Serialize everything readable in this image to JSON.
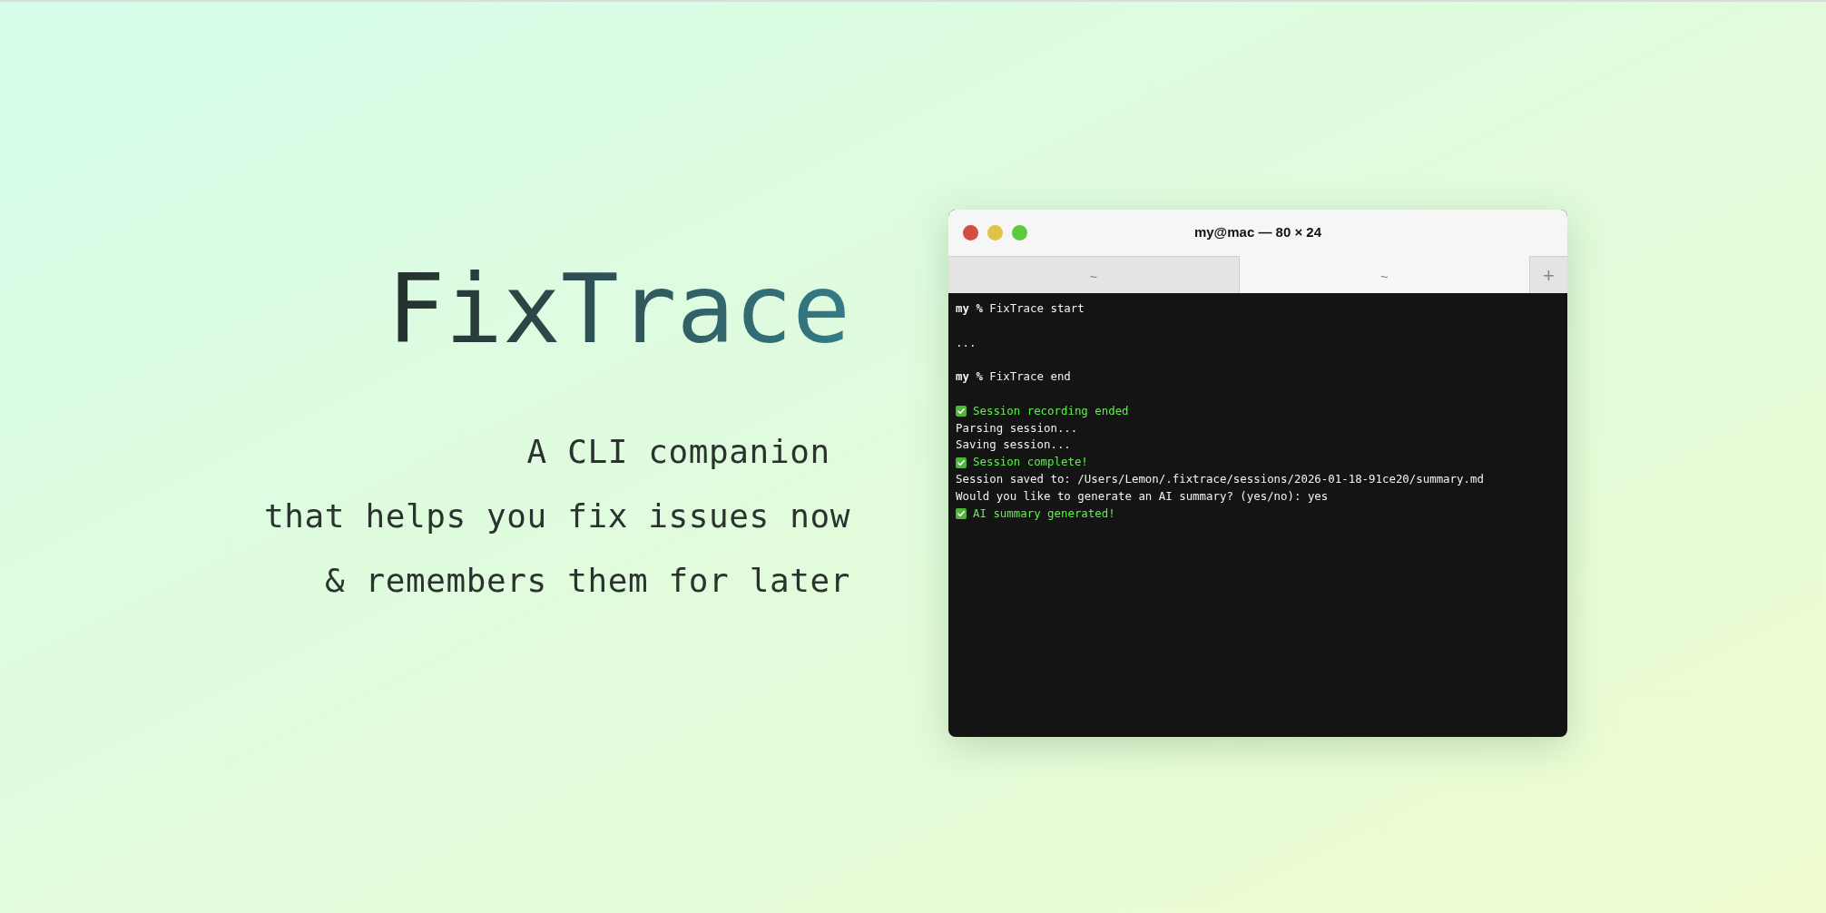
{
  "hero": {
    "title": "FixTrace",
    "tagline": [
      "A CLI companion ",
      "that helps you fix issues now",
      "& remembers them for later"
    ]
  },
  "terminal": {
    "window_title": "my@mac — 80 × 24",
    "traffic_lights": [
      {
        "color": "#d14d45"
      },
      {
        "color": "#e0c44a"
      },
      {
        "color": "#5cc93f"
      }
    ],
    "tabs": [
      {
        "label": "~",
        "selected": false
      },
      {
        "label": "~",
        "selected": true
      }
    ],
    "new_tab": "+",
    "lines": [
      {
        "kind": "prompt",
        "prompt": "my %",
        "command": "FixTrace start"
      },
      {
        "kind": "blank"
      },
      {
        "kind": "output",
        "text": "..."
      },
      {
        "kind": "blank"
      },
      {
        "kind": "prompt",
        "prompt": "my %",
        "command": "FixTrace end"
      },
      {
        "kind": "blank"
      },
      {
        "kind": "success",
        "text": "Session recording ended"
      },
      {
        "kind": "output",
        "text": "Parsing session..."
      },
      {
        "kind": "output",
        "text": "Saving session..."
      },
      {
        "kind": "success",
        "text": "Session complete!"
      },
      {
        "kind": "output",
        "text": "Session saved to: /Users/Lemon/.fixtrace/sessions/2026-01-18-91ce20/summary.md"
      },
      {
        "kind": "output",
        "text": "Would you like to generate an AI summary? (yes/no): yes"
      },
      {
        "kind": "success",
        "text": "AI summary generated!"
      }
    ]
  }
}
